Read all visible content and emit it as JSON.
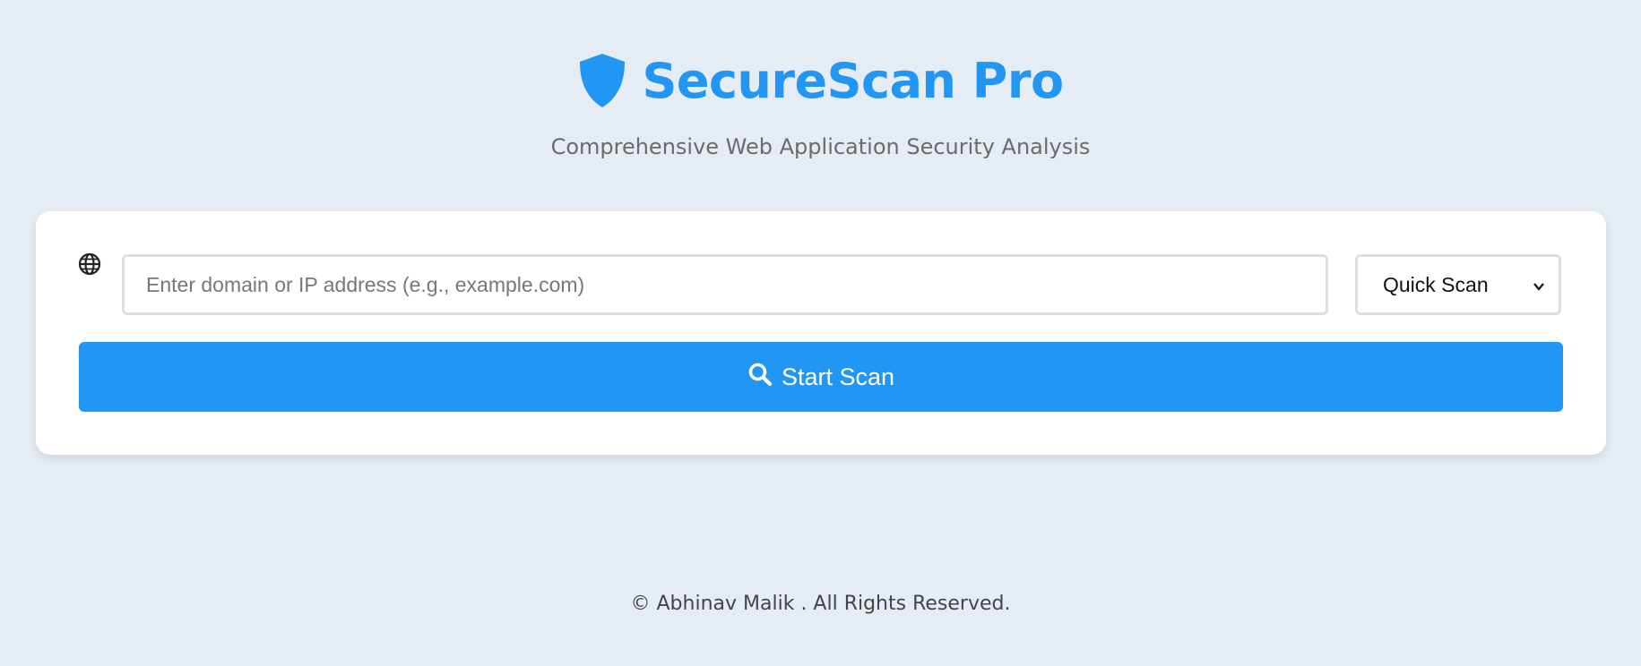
{
  "header": {
    "title": "SecureScan Pro",
    "subtitle": "Comprehensive Web Application Security Analysis",
    "logo_icon": "shield-icon"
  },
  "scan_form": {
    "globe_icon": "globe-icon",
    "domain_input": {
      "value": "",
      "placeholder": "Enter domain or IP address (e.g., example.com)"
    },
    "scan_type": {
      "selected": "Quick Scan"
    },
    "start_button": {
      "label": "Start Scan",
      "icon": "search-icon"
    }
  },
  "footer": {
    "text": "© Abhinav Malik . All Rights Reserved."
  },
  "colors": {
    "accent": "#2196f3",
    "background": "#e5ecf4",
    "card": "#ffffff"
  }
}
